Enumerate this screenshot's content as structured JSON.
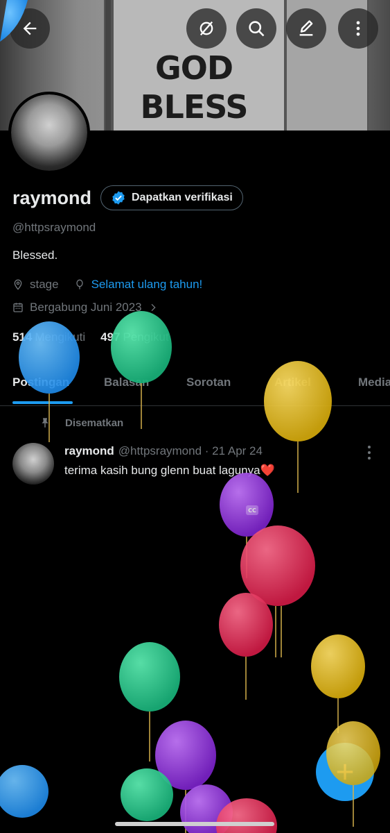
{
  "banner": {
    "line1": "GOD",
    "line2": "BLESS"
  },
  "toolbar": {
    "back": "back-arrow",
    "grok": "grok-icon",
    "search": "search-icon",
    "edit": "edit-icon",
    "more": "more-vertical-icon"
  },
  "profile": {
    "name": "raymond",
    "verify_label": "Dapatkan verifikasi",
    "handle": "@httpsraymond",
    "bio": "Blessed.",
    "location": "stage",
    "birthday": "Selamat ulang tahun!",
    "joined": "Bergabung Juni 2023",
    "following_count": "514",
    "following_label": "Mengikuti",
    "followers_count": "497",
    "followers_label": "Pengikut"
  },
  "tabs": [
    "Postingan",
    "Balasan",
    "Sorotan",
    "Artikel",
    "Media"
  ],
  "post": {
    "pinned_label": "Disematkan",
    "author": "raymond",
    "handle_date": "@httpsraymond · 21 Apr 24",
    "text": "terima kasih bung glenn buat lagunya❤️"
  },
  "overlay": {
    "cc": "CC"
  },
  "colors": {
    "accent": "#1d9bf0",
    "text": "#e7e9ea",
    "muted": "#71767b",
    "background": "#000000"
  }
}
